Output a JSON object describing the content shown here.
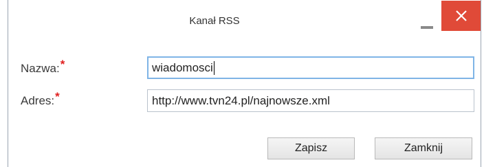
{
  "window": {
    "title": "Kanał RSS",
    "close_color": "#e04a38",
    "minimize_icon": "minimize-icon",
    "close_icon": "close-icon"
  },
  "form": {
    "name_label": "Nazwa:",
    "name_required_mark": "*",
    "name_value": "wiadomosci",
    "address_label": "Adres:",
    "address_required_mark": "*",
    "address_value": "http://www.tvn24.pl/najnowsze.xml"
  },
  "buttons": {
    "save_label": "Zapisz",
    "close_label": "Zamknij"
  }
}
